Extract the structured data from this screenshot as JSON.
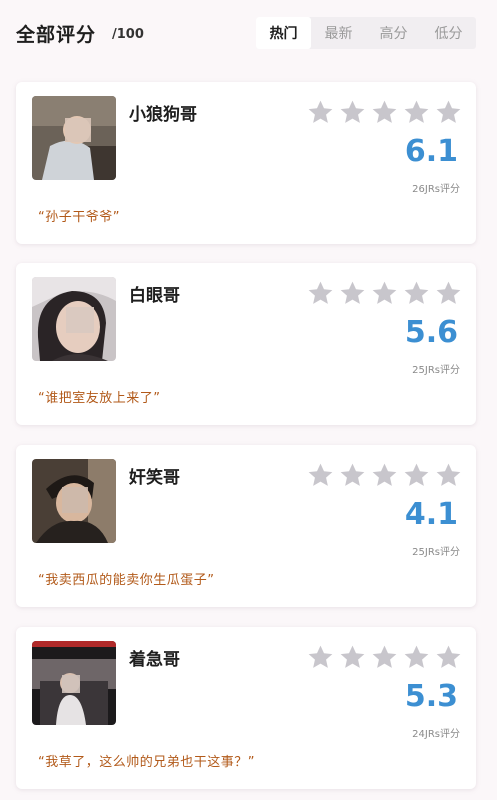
{
  "header": {
    "title": "全部评分",
    "title_suffix": "/100",
    "tabs": [
      {
        "label": "热门",
        "active": true
      },
      {
        "label": "最新",
        "active": false
      },
      {
        "label": "高分",
        "active": false
      },
      {
        "label": "低分",
        "active": false
      }
    ]
  },
  "colors": {
    "score": "#3c8fd2",
    "quote": "#b25a1a",
    "star_empty": "#c8c6cc",
    "tab_active_bg": "#ffffff",
    "tab_bg": "#f1eef1"
  },
  "entries": [
    {
      "name": "小狼狗哥",
      "score": "6.1",
      "votes": "26JRs评分",
      "quote": "“孙子干爷爷”",
      "stars_filled": 0,
      "avatar_icon": "person-photo-icon"
    },
    {
      "name": "白眼哥",
      "score": "5.6",
      "votes": "25JRs评分",
      "quote": "“谁把室友放上来了”",
      "stars_filled": 0,
      "avatar_icon": "person-photo-icon"
    },
    {
      "name": "奸笑哥",
      "score": "4.1",
      "votes": "25JRs评分",
      "quote": "“我卖西瓜的能卖你生瓜蛋子”",
      "stars_filled": 0,
      "avatar_icon": "person-photo-icon"
    },
    {
      "name": "着急哥",
      "score": "5.3",
      "votes": "24JRs评分",
      "quote": "“我草了，这么帅的兄弟也干这事？”",
      "stars_filled": 0,
      "avatar_icon": "person-photo-icon"
    }
  ]
}
